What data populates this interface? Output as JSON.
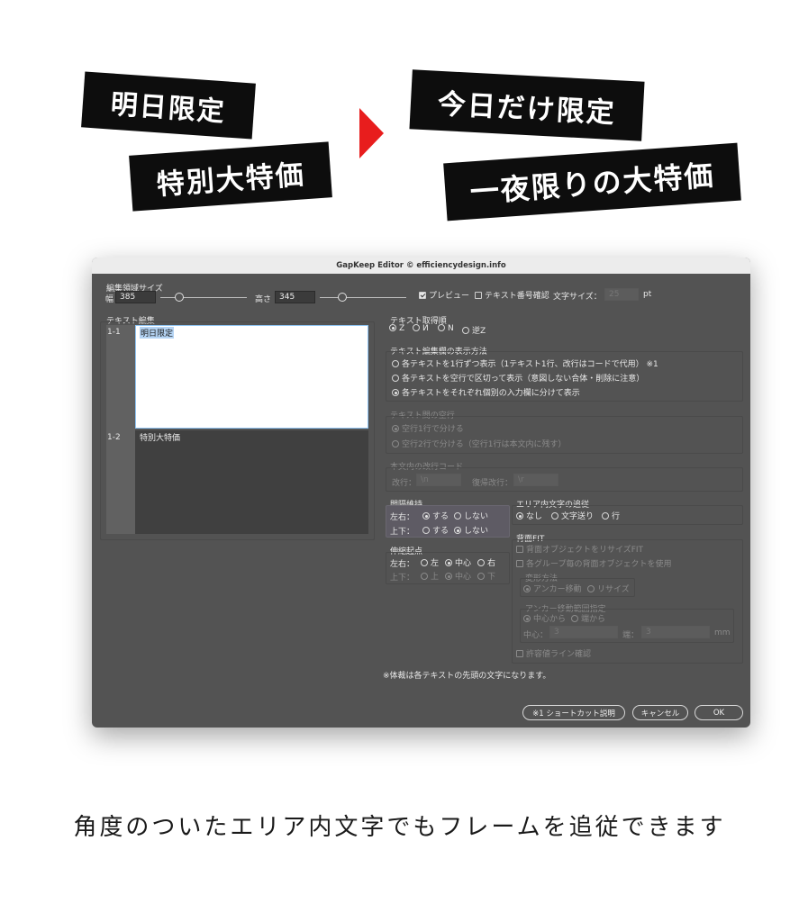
{
  "banners": {
    "before_line1": "明日限定",
    "before_line2": "特別大特価",
    "after_line1": "今日だけ限定",
    "after_line2": "一夜限りの大特価"
  },
  "colors": {
    "arrow": "#e81d1d",
    "banner_bg": "#0d0d0d",
    "dialog_bg": "#535353"
  },
  "dialog": {
    "title": "GapKeep Editor © efficiencydesign.info",
    "edit_area": {
      "label": "編集領域サイズ",
      "width_label": "幅",
      "width_value": "385",
      "height_label": "高さ",
      "height_value": "345"
    },
    "preview_label": "プレビュー",
    "text_number_label": "テキスト番号確認",
    "font_size_label": "文字サイズ：",
    "font_size_value": "25",
    "font_size_unit": "pt",
    "text_edit": {
      "label": "テキスト編集",
      "rows": [
        {
          "number": "1-1",
          "text": "明日限定"
        },
        {
          "number": "1-2",
          "text": "特別大特価"
        }
      ]
    },
    "order": {
      "label": "テキスト取得順",
      "options": [
        "Z",
        "И",
        "N",
        "逆Z"
      ],
      "selected": "Z"
    },
    "display_method": {
      "label": "テキスト編集欄の表示方法",
      "options": [
        "各テキストを1行ずつ表示（1テキスト1行、改行はコードで代用） ※1",
        "各テキストを空行で区切って表示（意図しない合体・削除に注意）",
        "各テキストをそれぞれ個別の入力欄に分けて表示"
      ],
      "selected_index": 2
    },
    "blank_lines": {
      "label": "テキスト間の空行",
      "options": [
        "空行1行で分ける",
        "空行2行で分ける（空行1行は本文内に残す）"
      ]
    },
    "line_break_code": {
      "label": "本文内の改行コード",
      "break_label": "改行：",
      "break_value": "\\n",
      "return_label": "復帰改行：",
      "return_value": "\\r"
    },
    "gap_keep": {
      "label": "間隔維持",
      "lr_label": "左右：",
      "ud_label": "上下：",
      "yes": "する",
      "no": "しない"
    },
    "follow": {
      "label": "エリア内文字の追従",
      "options": [
        "なし",
        "文字送り",
        "行"
      ]
    },
    "origin": {
      "label": "伸縮起点",
      "lr_label": "左右：",
      "ud_label": "上下：",
      "lr_options": [
        "左",
        "中心",
        "右"
      ],
      "ud_options": [
        "上",
        "中心",
        "下"
      ]
    },
    "bg_fit": {
      "label": "背面FIT",
      "resize_bg": "背面オブジェクトをリサイズFIT",
      "per_group": "各グループ毎の背面オブジェクトを使用",
      "transform_label": "変形方法",
      "transform_options": [
        "アンカー移動",
        "リサイズ"
      ],
      "anchor_label": "アンカー移動範囲指定",
      "anchor_options": [
        "中心から",
        "端から"
      ],
      "center_label": "中心：",
      "center_value": "3",
      "edge_label": "端：",
      "edge_value": "3",
      "unit": "mm",
      "tolerance": "許容値ライン確認"
    },
    "footnote": "※体裁は各テキストの先頭の文字になります。",
    "buttons": {
      "shortcut": "※1 ショートカット説明",
      "cancel": "キャンセル",
      "ok": "OK"
    }
  },
  "caption": "角度のついたエリア内文字でもフレームを追従できます"
}
